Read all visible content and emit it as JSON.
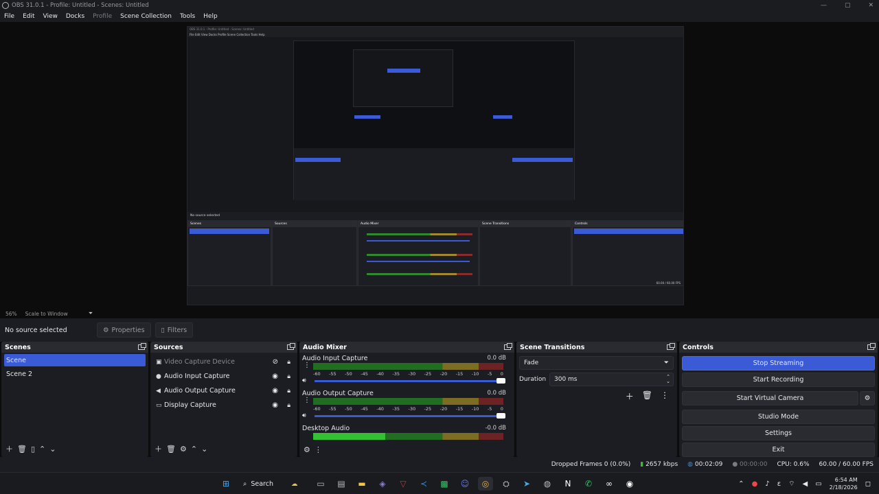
{
  "window": {
    "title": "OBS 31.0.1 - Profile: Untitled - Scenes: Untitled",
    "controls": [
      "—",
      "▢",
      "✕"
    ]
  },
  "menu": [
    "File",
    "Edit",
    "View",
    "Docks",
    "Profile",
    "Scene Collection",
    "Tools",
    "Help"
  ],
  "preview": {
    "zoom": "56%",
    "scale_mode": "Scale to Window",
    "nested_title": "OBS 31.0.1 - Profile: Untitled - Scenes: Untitled",
    "nested_menu": "File  Edit  View  Docks  Profile  Scene Collection  Tools  Help"
  },
  "source_toolbar": {
    "no_source": "No source selected",
    "properties": "Properties",
    "filters": "Filters"
  },
  "scenes": {
    "title": "Scenes",
    "items": [
      "Scene",
      "Scene 2"
    ],
    "active_index": 0
  },
  "sources": {
    "title": "Sources",
    "items": [
      {
        "label": "Video Capture Device",
        "icon": "camera-icon",
        "visible": false
      },
      {
        "label": "Audio Input Capture",
        "icon": "microphone-icon",
        "visible": true
      },
      {
        "label": "Audio Output Capture",
        "icon": "speaker-icon",
        "visible": true
      },
      {
        "label": "Display Capture",
        "icon": "monitor-icon",
        "visible": true
      }
    ]
  },
  "mixer": {
    "title": "Audio Mixer",
    "ticks": [
      "-60",
      "-55",
      "-50",
      "-45",
      "-40",
      "-35",
      "-30",
      "-25",
      "-20",
      "-15",
      "-10",
      "-5",
      "0"
    ],
    "channels": [
      {
        "name": "Audio Input Capture",
        "db": "0.0 dB",
        "level": 0.0,
        "volume": 1.0
      },
      {
        "name": "Audio Output Capture",
        "db": "0.0 dB",
        "level": 0.0,
        "volume": 1.0
      },
      {
        "name": "Desktop Audio",
        "db": "-0.0 dB",
        "level": 0.38,
        "volume": 1.0
      }
    ]
  },
  "transitions": {
    "title": "Scene Transitions",
    "selected": "Fade",
    "duration_label": "Duration",
    "duration_value": "300 ms"
  },
  "controls": {
    "title": "Controls",
    "buttons": [
      "Stop Streaming",
      "Start Recording",
      "Start Virtual Camera",
      "Studio Mode",
      "Settings",
      "Exit"
    ]
  },
  "status": {
    "dropped": "Dropped Frames 0 (0.0%)",
    "bitrate": "2657 kbps",
    "stream_time": "00:02:09",
    "rec_time": "00:00:00",
    "cpu": "CPU: 0.6%",
    "fps": "60.00 / 60.00 FPS"
  },
  "taskbar": {
    "search": "Search",
    "time": "6:54 AM",
    "date": "2/18/2026",
    "lang": "ε"
  },
  "colors": {
    "accent": "#3b5bd6",
    "panel": "#1c1d22",
    "header": "#2a2b31"
  }
}
